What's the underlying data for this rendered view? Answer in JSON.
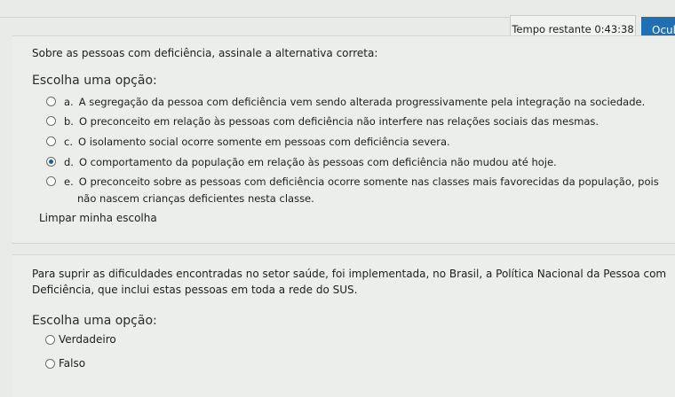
{
  "header": {
    "timer_label": "Tempo restante",
    "timer_value": "0:43:38",
    "hide_button": "Ocul"
  },
  "question1": {
    "text": "Sobre as pessoas com deficiência, assinale a alternativa correta:",
    "choose_label": "Escolha uma opção:",
    "options": [
      {
        "letter": "a.",
        "text": "A segregação da pessoa com deficiência vem sendo alterada progressivamente pela integração na sociedade.",
        "selected": false
      },
      {
        "letter": "b.",
        "text": "O preconceito em relação às pessoas com deficiência não interfere nas relações sociais das mesmas.",
        "selected": false
      },
      {
        "letter": "c.",
        "text": "O isolamento social ocorre somente em pessoas com deficiência severa.",
        "selected": false
      },
      {
        "letter": "d.",
        "text": "O comportamento da população em relação às pessoas com deficiência não mudou até hoje.",
        "selected": true
      },
      {
        "letter": "e.",
        "text": "O preconceito sobre as pessoas com deficiência ocorre somente nas classes mais favorecidas da população, pois",
        "continuation": "não nascem crianças deficientes nesta classe.",
        "selected": false
      }
    ],
    "clear_label": "Limpar minha escolha"
  },
  "question2": {
    "text_line1": "Para suprir as dificuldades encontradas no setor saúde, foi implementada, no Brasil, a Política Nacional da Pessoa com",
    "text_line2": "Deficiência, que inclui estas pessoas em toda a rede do SUS.",
    "choose_label": "Escolha uma opção:",
    "options": [
      {
        "text": "Verdadeiro",
        "selected": false
      },
      {
        "text": "Falso",
        "selected": false
      }
    ]
  },
  "colors": {
    "accent": "#1f6fb2",
    "selected_radio": "#1b5da8",
    "background": "#e9ebe9"
  }
}
